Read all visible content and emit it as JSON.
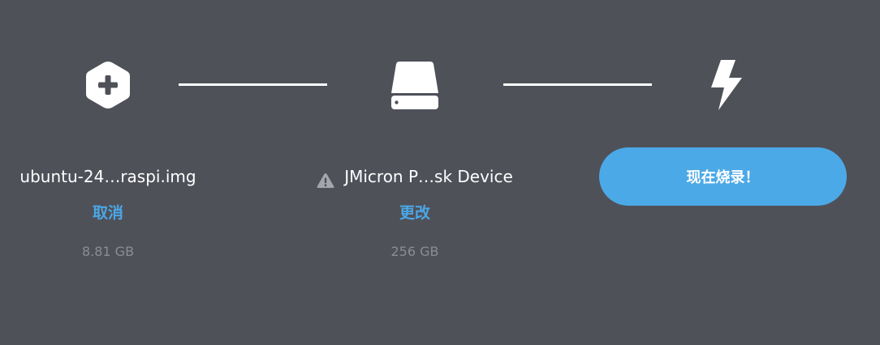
{
  "image_step": {
    "icon": "plus-hexagon-icon",
    "file_name": "ubuntu-24…raspi.img",
    "action_label": "取消",
    "size": "8.81 GB"
  },
  "drive_step": {
    "icon": "drive-icon",
    "warning_icon": "warning-triangle-icon",
    "drive_name": "JMicron P…sk Device",
    "action_label": "更改",
    "size": "256 GB"
  },
  "flash_step": {
    "icon": "lightning-bolt-icon",
    "button_label": "现在烧录！"
  },
  "colors": {
    "background": "#4f5159",
    "accent": "#4ca9e7",
    "muted_text": "#8a8d95",
    "foreground": "#ffffff"
  }
}
